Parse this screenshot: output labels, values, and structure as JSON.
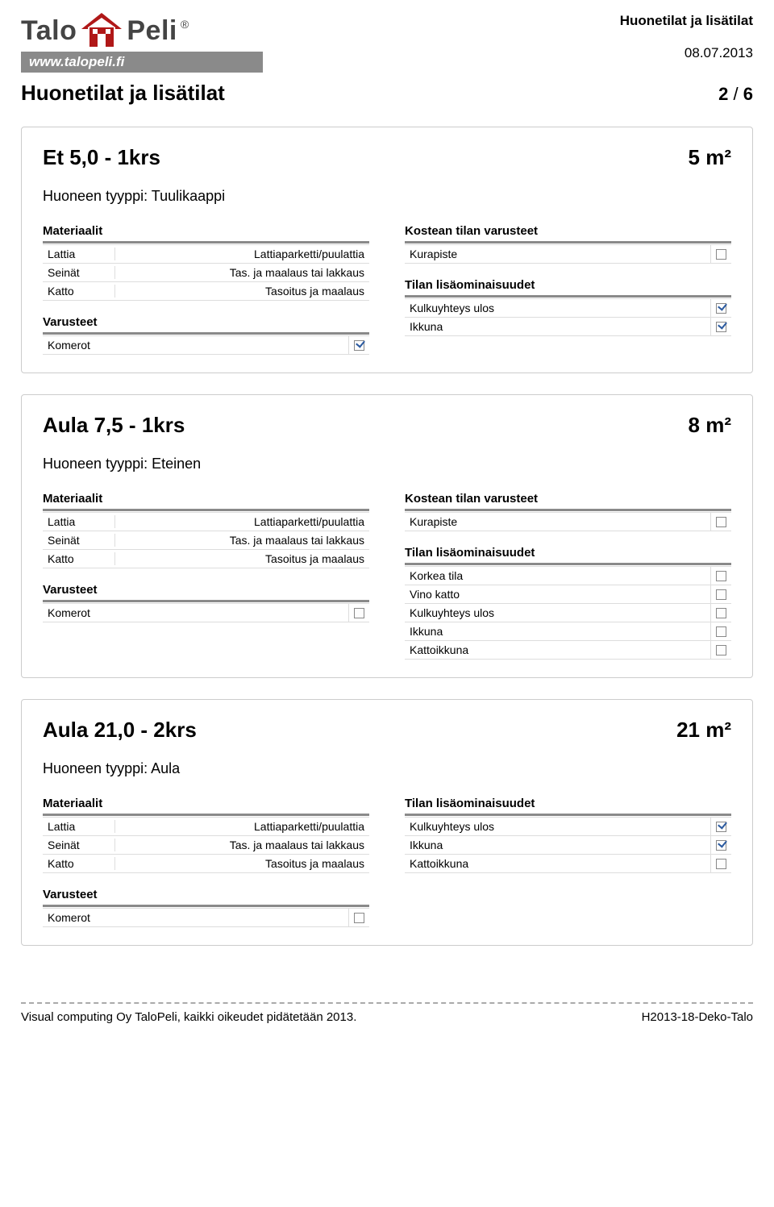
{
  "header": {
    "brand_left": "Talo",
    "brand_right": "Peli",
    "reg": "®",
    "url": "www.talopeli.fi",
    "title": "Huonetilat ja lisätilat",
    "date": "08.07.2013"
  },
  "page": {
    "title": "Huonetilat ja lisätilat",
    "page_current": "2",
    "page_total": "6"
  },
  "labels": {
    "materiaalit": "Materiaalit",
    "varusteet": "Varusteet",
    "kostean": "Kostean tilan varusteet",
    "lisa": "Tilan lisäominaisuudet",
    "kurapiste": "Kurapiste",
    "komerot": "Komerot",
    "lattia": "Lattia",
    "seinat": "Seinät",
    "katto": "Katto",
    "kulku": "Kulkuyhteys ulos",
    "ikkuna": "Ikkuna",
    "korkea": "Korkea tila",
    "vino": "Vino katto",
    "kattoikkuna": "Kattoikkuna"
  },
  "mat": {
    "lattia_val": "Lattiaparketti/puulattia",
    "seinat_val": "Tas. ja maalaus tai lakkaus",
    "katto_val": "Tasoitus ja maalaus"
  },
  "rooms": [
    {
      "name": "Et 5,0 - 1krs",
      "area": "5 m²",
      "type_label": "Huoneen tyyppi: Tuulikaappi",
      "left": [
        {
          "kind": "h",
          "text": "materiaalit"
        },
        {
          "kind": "kv",
          "label": "lattia",
          "val": "lattia_val"
        },
        {
          "kind": "kv",
          "label": "seinat",
          "val": "seinat_val"
        },
        {
          "kind": "kv",
          "label": "katto",
          "val": "katto_val"
        },
        {
          "kind": "h",
          "text": "varusteet"
        },
        {
          "kind": "check",
          "label": "komerot",
          "checked": true
        }
      ],
      "right": [
        {
          "kind": "h",
          "text": "kostean"
        },
        {
          "kind": "check",
          "label": "kurapiste",
          "checked": false
        },
        {
          "kind": "h",
          "text": "lisa"
        },
        {
          "kind": "check",
          "label": "kulku",
          "checked": true
        },
        {
          "kind": "check",
          "label": "ikkuna",
          "checked": true
        }
      ]
    },
    {
      "name": "Aula 7,5 - 1krs",
      "area": "8 m²",
      "type_label": "Huoneen tyyppi: Eteinen",
      "left": [
        {
          "kind": "h",
          "text": "materiaalit"
        },
        {
          "kind": "kv",
          "label": "lattia",
          "val": "lattia_val"
        },
        {
          "kind": "kv",
          "label": "seinat",
          "val": "seinat_val"
        },
        {
          "kind": "kv",
          "label": "katto",
          "val": "katto_val"
        },
        {
          "kind": "h",
          "text": "varusteet"
        },
        {
          "kind": "check",
          "label": "komerot",
          "checked": false
        }
      ],
      "right": [
        {
          "kind": "h",
          "text": "kostean"
        },
        {
          "kind": "check",
          "label": "kurapiste",
          "checked": false
        },
        {
          "kind": "h",
          "text": "lisa"
        },
        {
          "kind": "check",
          "label": "korkea",
          "checked": false
        },
        {
          "kind": "check",
          "label": "vino",
          "checked": false
        },
        {
          "kind": "check",
          "label": "kulku",
          "checked": false
        },
        {
          "kind": "check",
          "label": "ikkuna",
          "checked": false
        },
        {
          "kind": "check",
          "label": "kattoikkuna",
          "checked": false
        }
      ]
    },
    {
      "name": "Aula 21,0 - 2krs",
      "area": "21 m²",
      "type_label": "Huoneen tyyppi: Aula",
      "left": [
        {
          "kind": "h",
          "text": "materiaalit"
        },
        {
          "kind": "kv",
          "label": "lattia",
          "val": "lattia_val"
        },
        {
          "kind": "kv",
          "label": "seinat",
          "val": "seinat_val"
        },
        {
          "kind": "kv",
          "label": "katto",
          "val": "katto_val"
        },
        {
          "kind": "h",
          "text": "varusteet"
        },
        {
          "kind": "check",
          "label": "komerot",
          "checked": false
        }
      ],
      "right": [
        {
          "kind": "h",
          "text": "lisa"
        },
        {
          "kind": "check",
          "label": "kulku",
          "checked": true
        },
        {
          "kind": "check",
          "label": "ikkuna",
          "checked": true
        },
        {
          "kind": "check",
          "label": "kattoikkuna",
          "checked": false
        }
      ]
    }
  ],
  "footer": {
    "left": "Visual computing Oy TaloPeli, kaikki oikeudet pidätetään 2013.",
    "right": "H2013-18-Deko-Talo"
  }
}
